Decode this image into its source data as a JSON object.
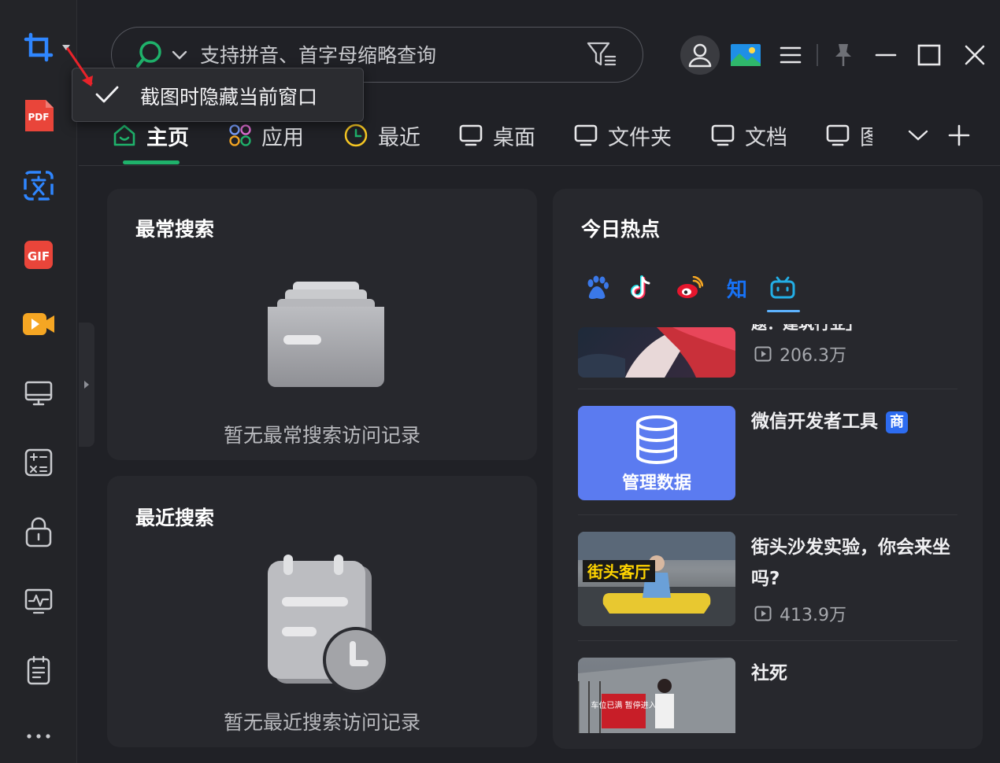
{
  "search": {
    "placeholder": "支持拼音、首字母缩略查询"
  },
  "popup": {
    "label": "截图时隐藏当前窗口"
  },
  "tabs": [
    {
      "label": "主页"
    },
    {
      "label": "应用"
    },
    {
      "label": "最近"
    },
    {
      "label": "桌面"
    },
    {
      "label": "文件夹"
    },
    {
      "label": "文档"
    },
    {
      "label": "图"
    }
  ],
  "sidebar": {
    "pdf_label": "PDF",
    "gif_label": "GIF"
  },
  "frequent": {
    "title": "最常搜索",
    "empty": "暂无最常搜索访问记录"
  },
  "recent": {
    "title": "最近搜索",
    "empty": "暂无最近搜索访问记录"
  },
  "hot": {
    "title": "今日热点",
    "source_tabs": [
      "baidu-icon",
      "douyin-icon",
      "weibo-icon",
      "zhihu-icon",
      "bilibili-icon"
    ],
    "zhihu_glyph": "知",
    "items": [
      {
        "title": "题：建筑行业」",
        "views": "206.3万"
      },
      {
        "title": "微信开发者工具",
        "badge": "商",
        "thumb_text": "管理数据"
      },
      {
        "title": "街头沙发实验，你会来坐吗?",
        "views": "413.9万",
        "thumb_text": "街头客厅"
      },
      {
        "title": "社死",
        "views": "",
        "thumb_text": "车位已满 暂停进入"
      }
    ]
  },
  "colors": {
    "accent_green": "#1fb26b",
    "accent_blue": "#5db3ff",
    "background": "#202126",
    "panel": "#27282d"
  }
}
